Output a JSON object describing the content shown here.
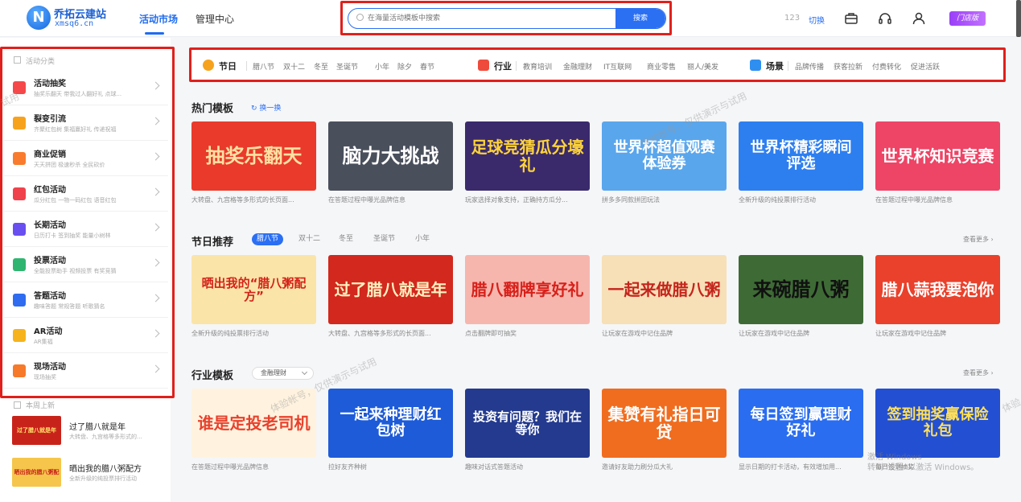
{
  "header": {
    "logo_char": "N",
    "brand_name": "乔拓云建站",
    "brand_domain": "xmsq6.cn",
    "nav": [
      "活动市场",
      "管理中心"
    ],
    "search_placeholder": "在海量活动模板中搜索",
    "search_button": "搜索",
    "account_num": "123",
    "switch_label": "切换",
    "store_badge": "门店版"
  },
  "filters": {
    "festival": {
      "label": "节日",
      "tags": [
        "腊八节",
        "双十二",
        "冬至",
        "圣诞节",
        "小年",
        "除夕",
        "春节"
      ]
    },
    "industry": {
      "label": "行业",
      "tags": [
        "教育培训",
        "金融理财",
        "IT互联网",
        "商业零售",
        "丽人/美发"
      ]
    },
    "scene": {
      "label": "场景",
      "tags": [
        "品牌传播",
        "获客拉新",
        "付费转化",
        "促进活跃"
      ]
    }
  },
  "sidebar": {
    "category_title": "活动分类",
    "categories": [
      {
        "name": "活动抽奖",
        "desc": "抽奖乐翻天   带我过人翻好礼   点球...",
        "color": "#f5484a"
      },
      {
        "name": "裂变引流",
        "desc": "齐聚红包树   集福赢好礼   传递祝福",
        "color": "#f7a21c"
      },
      {
        "name": "商业促销",
        "desc": "天天拼团   极速秒杀   全民砍价",
        "color": "#f97b2d"
      },
      {
        "name": "红包活动",
        "desc": "瓜分红包   一物一码红包   语音红包",
        "color": "#f0424c"
      },
      {
        "name": "长期活动",
        "desc": "日历打卡   签到抽奖   能量小树林",
        "color": "#6a4ff0"
      },
      {
        "name": "投票活动",
        "desc": "全能投票助手   视频投票   有奖竞猜",
        "color": "#2fb56f"
      },
      {
        "name": "答题活动",
        "desc": "趣味答题   常规答题   听歌猜名",
        "color": "#2f6cf0"
      },
      {
        "name": "AR活动",
        "desc": "AR集福",
        "color": "#f6b31c"
      },
      {
        "name": "现场活动",
        "desc": "现场抽奖",
        "color": "#f7792a"
      }
    ],
    "week_title": "本周上新",
    "week_items": [
      {
        "name": "过了腊八就是年",
        "desc": "大转盘、九宫格等多形式的...",
        "thumb": "过了腊八就是年"
      },
      {
        "name": "晒出我的腊八粥配方",
        "desc": "全新升级的纯投票排行活动",
        "thumb": "晒出我的腊八粥配方"
      }
    ]
  },
  "hot": {
    "title": "热门模板",
    "refresh": "换一换",
    "cards": [
      {
        "text": "抽奖乐翻天",
        "cap": "大转盘、九宫格等多形式的长页面...",
        "bg": "#e93a2c",
        "fg": "#ffe1a3"
      },
      {
        "text": "脑力大挑战",
        "cap": "在答题过程中曝光品牌信息",
        "bg": "#4a4f5c",
        "fg": "#ffffff"
      },
      {
        "text": "足球竞猜瓜分壕礼",
        "cap": "玩家选择对象支持，正确持方瓜分...",
        "bg": "#3a2a6c",
        "fg": "#ffd43a"
      },
      {
        "text": "世界杯超值观赛体验券",
        "cap": "拼多多同款拼团玩法",
        "bg": "#5aa6ec",
        "fg": "#ffffff"
      },
      {
        "text": "世界杯精彩瞬间评选",
        "cap": "全新升级的纯投票排行活动",
        "bg": "#2d7ff0",
        "fg": "#ffffff"
      },
      {
        "text": "世界杯知识竞赛",
        "cap": "在答题过程中曝光品牌信息",
        "bg": "#ee4466",
        "fg": "#ffffff"
      }
    ]
  },
  "festival": {
    "title": "节日推荐",
    "chips": [
      "腊八节",
      "双十二",
      "冬至",
      "圣诞节",
      "小年"
    ],
    "more": "查看更多",
    "cards": [
      {
        "text": "晒出我的“腊八粥配方”",
        "cap": "全新升级的纯投票排行活动",
        "bg": "#fbe4a8",
        "fg": "#d3221a"
      },
      {
        "text": "过了腊八就是年",
        "cap": "大转盘、九宫格等多形式的长页面...",
        "bg": "#d2281d",
        "fg": "#fff2c0"
      },
      {
        "text": "腊八翻牌享好礼",
        "cap": "点击翻牌即可抽奖",
        "bg": "#f6b6ae",
        "fg": "#d8201a"
      },
      {
        "text": "一起来做腊八粥",
        "cap": "让玩家在游戏中记住品牌",
        "bg": "#f7dfb7",
        "fg": "#c4241c"
      },
      {
        "text": "来碗腊八粥",
        "cap": "让玩家在游戏中记住品牌",
        "bg": "#3e6b35",
        "fg": "#111111"
      },
      {
        "text": "腊八蒜我要泡你",
        "cap": "让玩家在游戏中记住品牌",
        "bg": "#e9412b",
        "fg": "#ffffff"
      }
    ]
  },
  "industry": {
    "title": "行业模板",
    "dropdown": "金融理财",
    "more": "查看更多",
    "cards": [
      {
        "text": "谁是定投老司机",
        "cap": "在答题过程中曝光品牌信息",
        "bg": "#fff3df",
        "fg": "#e8412c"
      },
      {
        "text": "一起来种理财红包树",
        "cap": "拉好友齐种树",
        "bg": "#1d5bd8",
        "fg": "#ffffff"
      },
      {
        "text": "投资有问题？我们在等你",
        "cap": "趣味对话式答题活动",
        "bg": "#233a8f",
        "fg": "#ffffff"
      },
      {
        "text": "集赞有礼指日可贷",
        "cap": "邀请好友助力刷分瓜大礼",
        "bg": "#f06d1f",
        "fg": "#ffffff"
      },
      {
        "text": "每日签到赢理财好礼",
        "cap": "显示日期的打卡活动，有效增加用...",
        "bg": "#2a6df0",
        "fg": "#ffffff"
      },
      {
        "text": "签到抽奖赢保险礼包",
        "cap": "每日签到抽奖",
        "bg": "#234fd2",
        "fg": "#ffe05a"
      }
    ]
  },
  "watermark": "体验帐号，仅供演示与试用",
  "watermark_short": "试用",
  "watermark_end": "体验",
  "activate": {
    "line1": "激活 Windows",
    "line2": "转到“设置”以激活 Windows。"
  }
}
